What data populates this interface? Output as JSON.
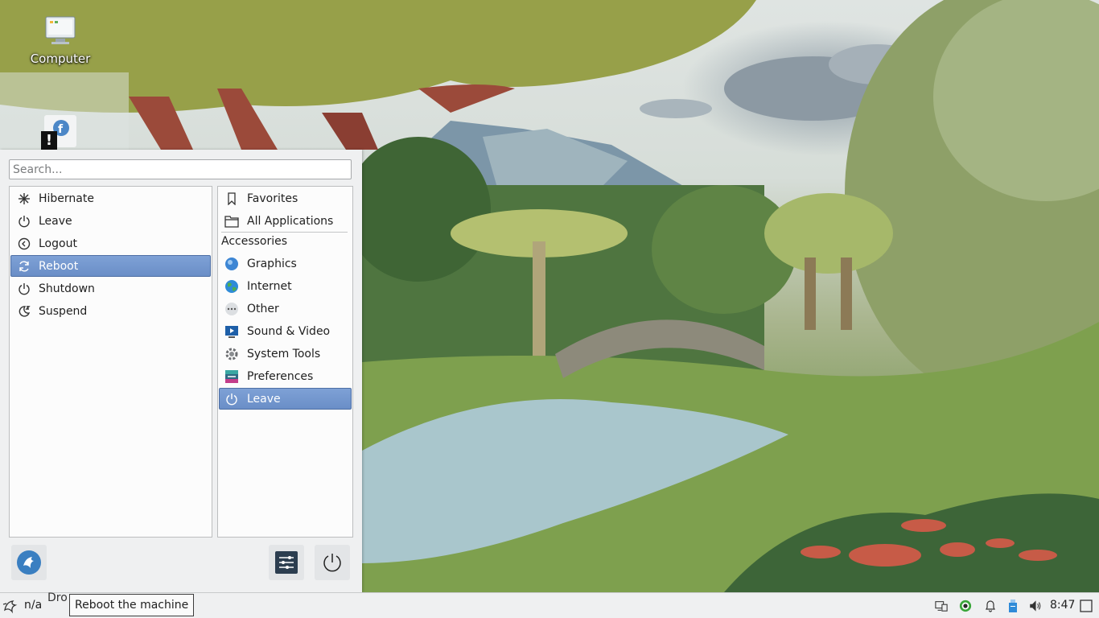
{
  "desktop": {
    "icons": [
      {
        "label": "Computer"
      }
    ]
  },
  "menu": {
    "search_placeholder": "Search...",
    "left_items": [
      {
        "label": "Hibernate",
        "icon": "snowflake-icon"
      },
      {
        "label": "Leave",
        "icon": "power-icon"
      },
      {
        "label": "Logout",
        "icon": "logout-icon"
      },
      {
        "label": "Reboot",
        "icon": "reboot-icon",
        "selected": true
      },
      {
        "label": "Shutdown",
        "icon": "power-icon"
      },
      {
        "label": "Suspend",
        "icon": "suspend-icon"
      }
    ],
    "right_top": [
      {
        "label": "Favorites",
        "icon": "bookmark-icon"
      },
      {
        "label": "All Applications",
        "icon": "folder-icon"
      }
    ],
    "category_header": "Accessories",
    "categories": [
      {
        "label": "Graphics",
        "icon": "graphics-icon"
      },
      {
        "label": "Internet",
        "icon": "globe-icon"
      },
      {
        "label": "Other",
        "icon": "dots-icon"
      },
      {
        "label": "Sound & Video",
        "icon": "media-icon"
      },
      {
        "label": "System Tools",
        "icon": "gear-icon"
      },
      {
        "label": "Preferences",
        "icon": "preferences-icon"
      },
      {
        "label": "Leave",
        "icon": "power-icon",
        "selected": true
      }
    ],
    "accent": "#6a8ec7"
  },
  "taskbar": {
    "task_label": "n/a",
    "drop_hint": "Dro",
    "tooltip": "Reboot the machine",
    "clock": "8:47"
  }
}
